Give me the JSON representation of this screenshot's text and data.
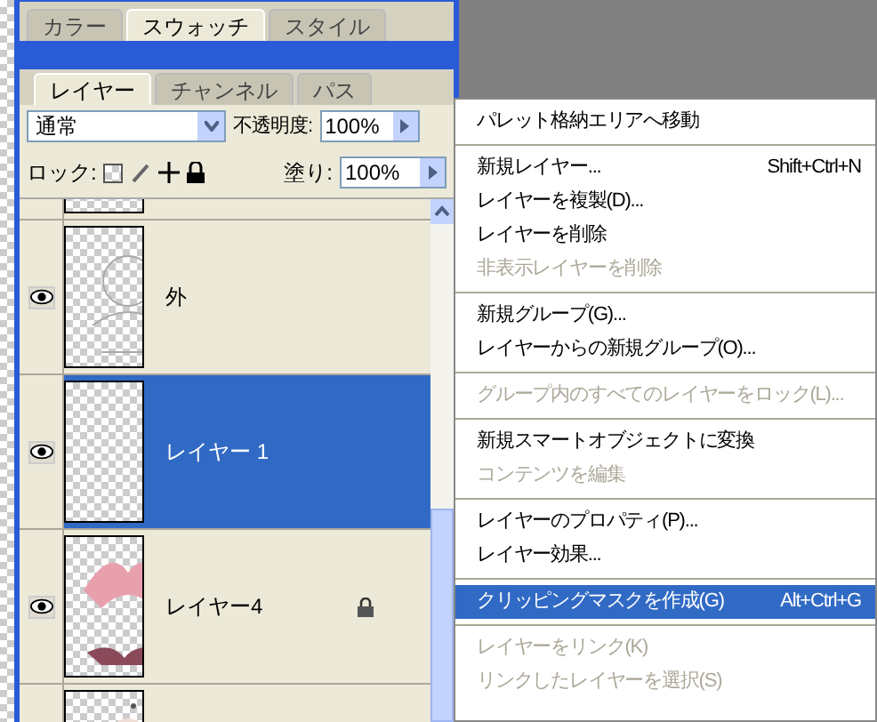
{
  "swatch_palette": {
    "tabs": [
      {
        "label": "カラー",
        "selected": false
      },
      {
        "label": "スウォッチ",
        "selected": true
      },
      {
        "label": "スタイル",
        "selected": false
      }
    ]
  },
  "layers_palette": {
    "tabs": [
      {
        "label": "レイヤー",
        "selected": true
      },
      {
        "label": "チャンネル",
        "selected": false
      },
      {
        "label": "パス",
        "selected": false
      }
    ],
    "blend_mode": "通常",
    "opacity_label": "不透明度:",
    "opacity": "100%",
    "lock_label": "ロック:",
    "fill_label": "塗り:",
    "fill": "100%",
    "layers": [
      {
        "selected": false
      },
      {
        "name": "外",
        "visible": true,
        "selected": false,
        "locked": false
      },
      {
        "name": "レイヤー 1",
        "visible": true,
        "selected": true,
        "locked": false
      },
      {
        "name": "レイヤー4",
        "visible": true,
        "selected": false,
        "locked": true
      },
      {
        "selected": false
      }
    ]
  },
  "context_menu": {
    "sections": [
      [
        {
          "label": "パレット格納エリアへ移動",
          "disabled": false,
          "selected": false
        }
      ],
      [
        {
          "label": "新規レイヤー...",
          "shortcut": "Shift+Ctrl+N",
          "disabled": false,
          "selected": false
        },
        {
          "label": "レイヤーを複製(D)...",
          "disabled": false,
          "selected": false
        },
        {
          "label": "レイヤーを削除",
          "disabled": false,
          "selected": false
        },
        {
          "label": "非表示レイヤーを削除",
          "disabled": true,
          "selected": false
        }
      ],
      [
        {
          "label": "新規グループ(G)...",
          "disabled": false,
          "selected": false
        },
        {
          "label": "レイヤーからの新規グループ(O)...",
          "disabled": false,
          "selected": false
        }
      ],
      [
        {
          "label": "グループ内のすべてのレイヤーをロック(L)...",
          "disabled": true,
          "selected": false
        }
      ],
      [
        {
          "label": "新規スマートオブジェクトに変換",
          "disabled": false,
          "selected": false
        },
        {
          "label": "コンテンツを編集",
          "disabled": true,
          "selected": false
        }
      ],
      [
        {
          "label": "レイヤーのプロパティ(P)...",
          "disabled": false,
          "selected": false
        },
        {
          "label": "レイヤー効果...",
          "disabled": false,
          "selected": false
        }
      ],
      [
        {
          "label": "クリッピングマスクを作成(G)",
          "shortcut": "Alt+Ctrl+G",
          "disabled": false,
          "selected": true
        }
      ],
      [
        {
          "label": "レイヤーをリンク(K)",
          "disabled": true,
          "selected": false
        },
        {
          "label": "リンクしたレイヤーを選択(S)",
          "disabled": true,
          "selected": false
        }
      ]
    ]
  }
}
